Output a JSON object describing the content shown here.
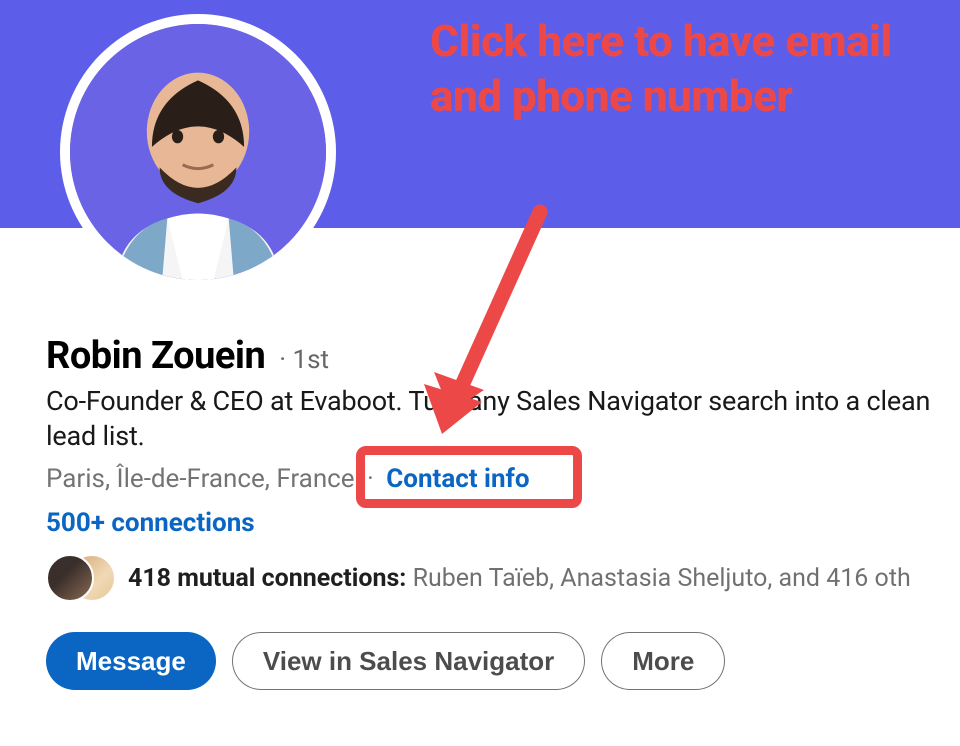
{
  "profile": {
    "name": "Robin Zouein",
    "degree": "· 1st",
    "headline": "Co-Founder & CEO at Evaboot. Turn any Sales Navigator search into a clean lead list.",
    "location": "Paris, Île-de-France, France",
    "contact_label": "Contact info",
    "connections": "500+ connections",
    "mutual_count_label": "418 mutual connections:",
    "mutual_names": "Ruben Taïeb, Anastasia Sheljuto, and 416 oth"
  },
  "actions": {
    "message": "Message",
    "view_sn": "View in Sales Navigator",
    "more": "More"
  },
  "annotation": {
    "text": "Click here to have email and phone number"
  }
}
